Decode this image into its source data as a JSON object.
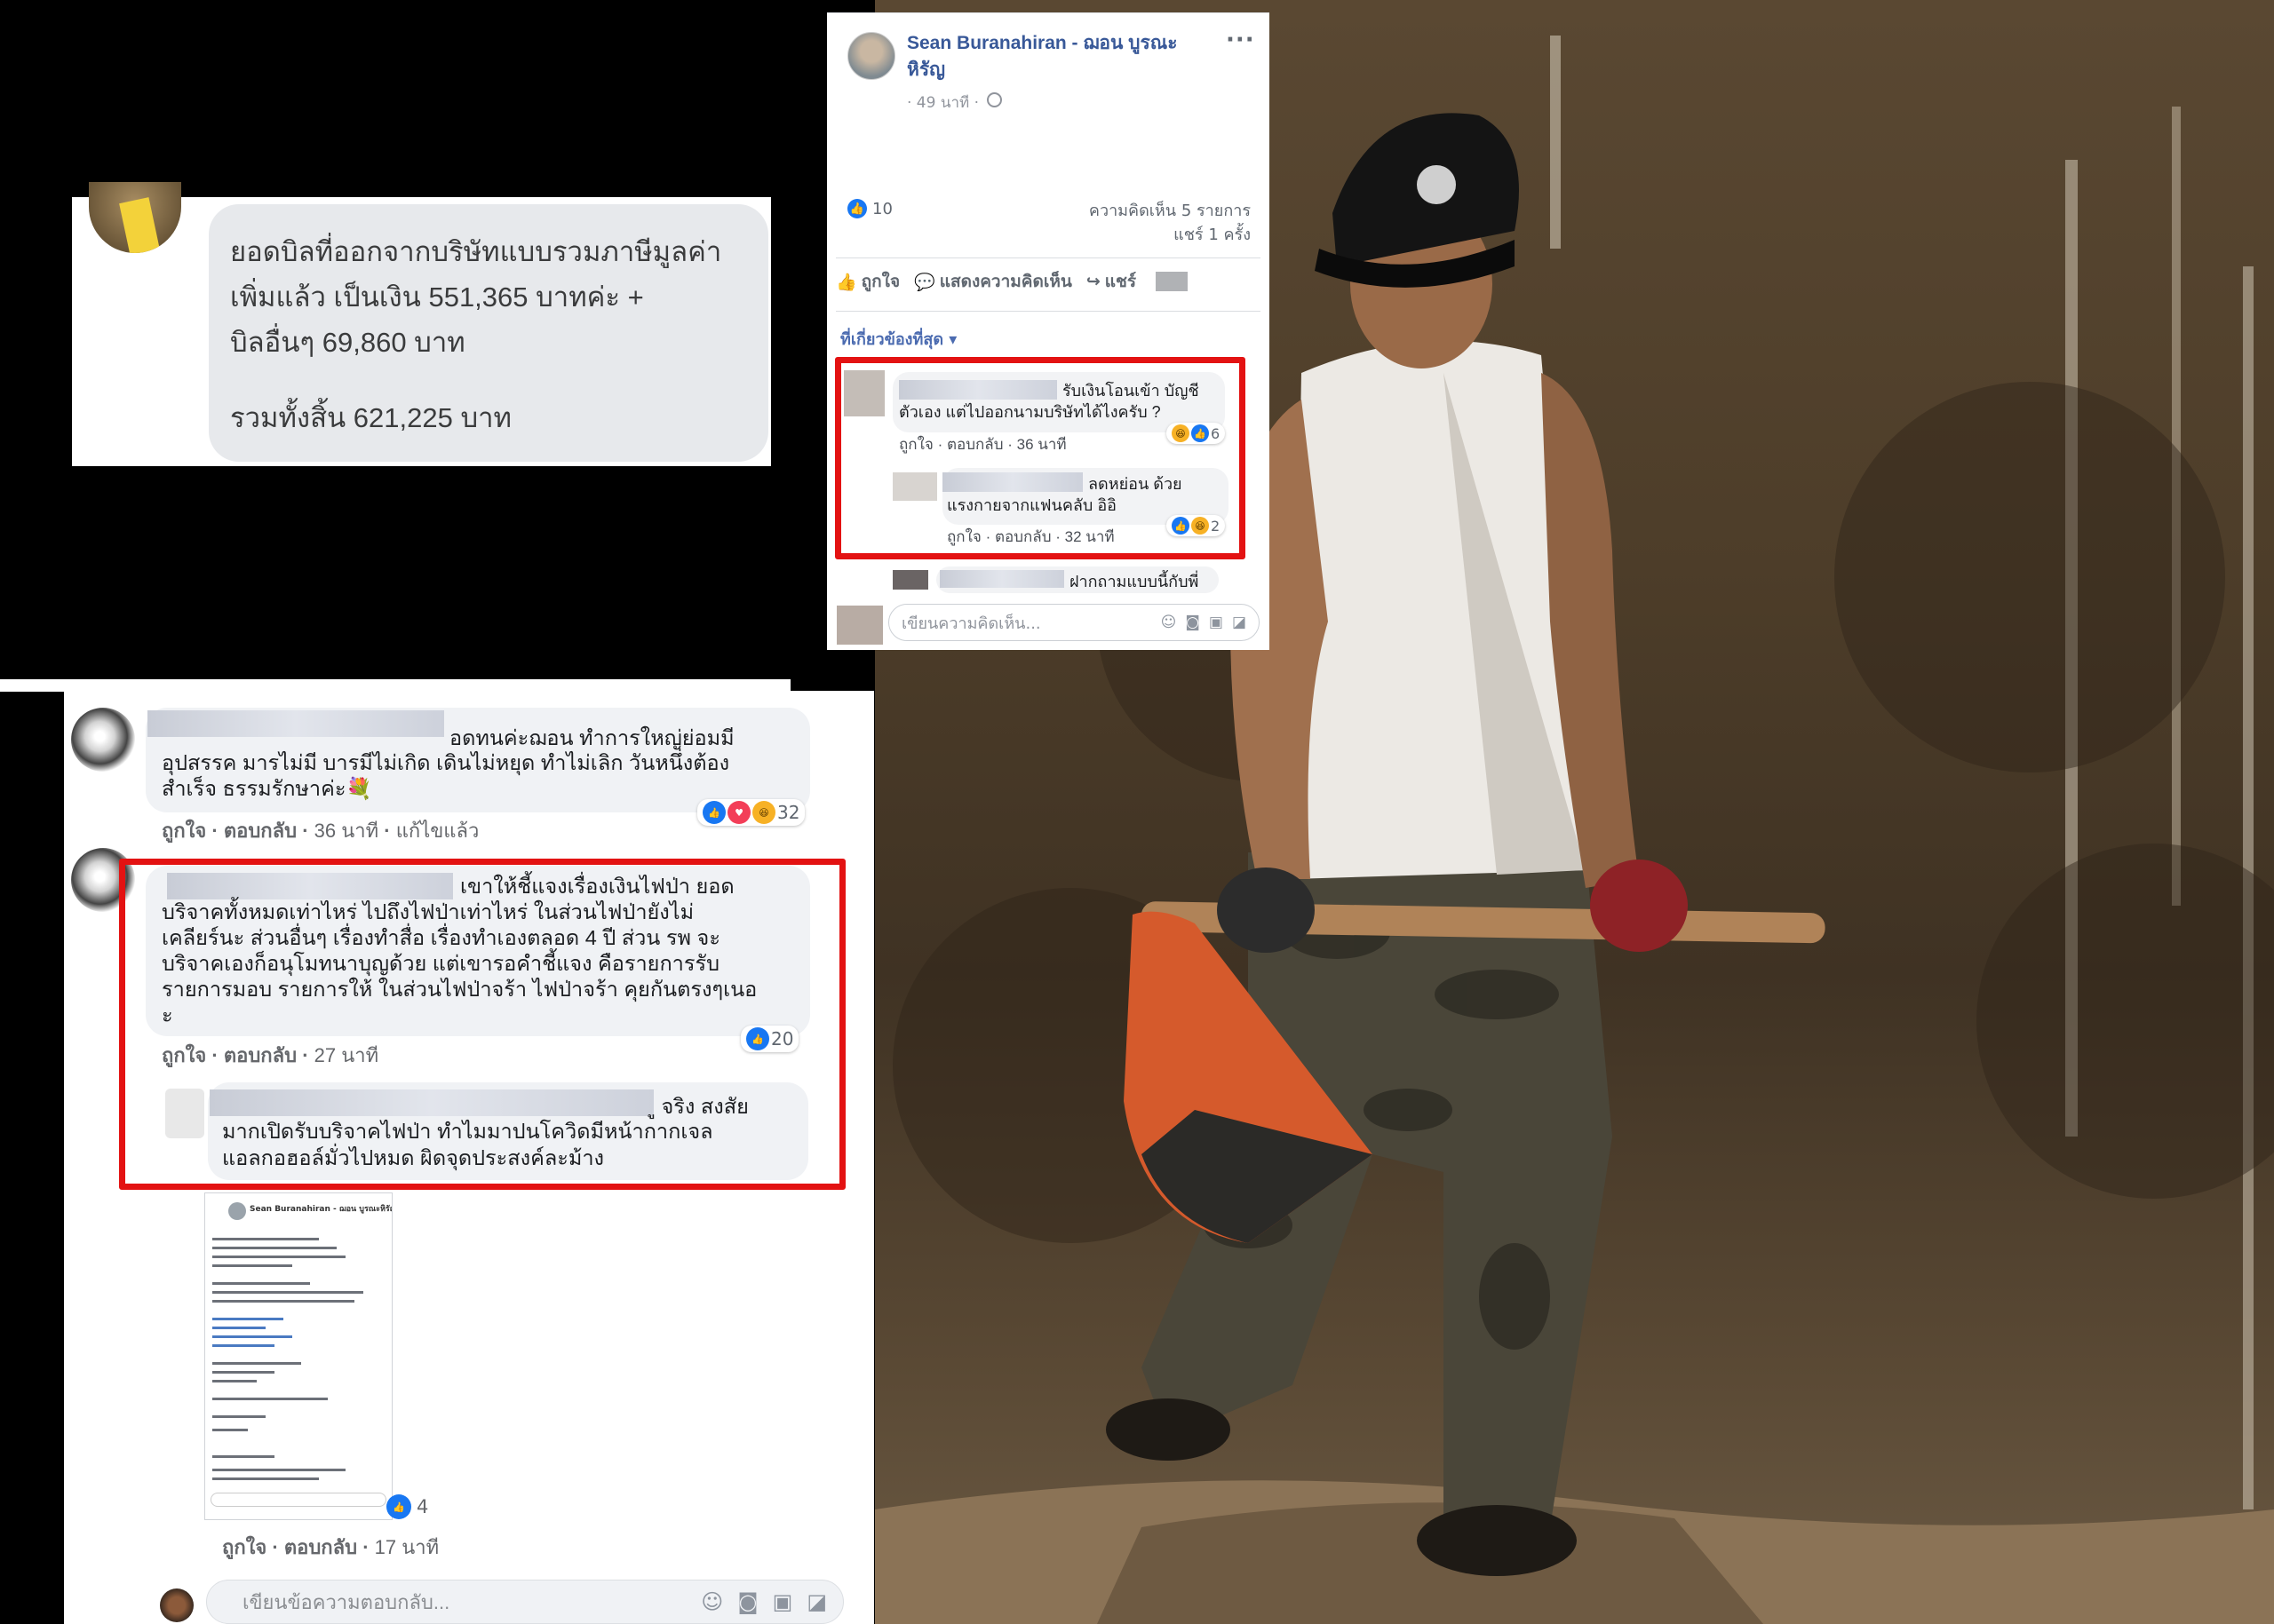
{
  "chat": {
    "line1": "ยอดบิลที่ออกจากบริษัทแบบรวมภาษีมูลค่า",
    "line2": "เพิ่มแล้ว เป็นเงิน 551,365 บาทค่ะ +",
    "line3": "บิลอื่นๆ 69,860 บาท",
    "total": "รวมทั้งสิ้น 621,225 บาท"
  },
  "post": {
    "author": "Sean Buranahiran - ฌอน บูรณะหิรัญ",
    "more": "···",
    "time": "· 49 นาที ·",
    "like_count": "10",
    "comments_count": "ความคิดเห็น 5 รายการ",
    "shares_count": "แชร์ 1 ครั้ง",
    "action_like": "ถูกใจ",
    "action_comment": "แสดงความคิดเห็น",
    "action_share": "แชร์",
    "relevance": "ที่เกี่ยวข้องที่สุด ▾",
    "input_placeholder": "เขียนความคิดเห็น...",
    "comments": [
      {
        "line1": "รับเงินโอนเข้า บัญชี",
        "line2": "ตัวเอง แต่ไปออกนามบริษัทได้ไงครับ ?",
        "reactions": "6",
        "meta_like": "ถูกใจ",
        "meta_reply": "ตอบกลับ",
        "meta_time": "36 นาที"
      },
      {
        "line1": "ลดหย่อน ด้วย",
        "line2": "แรงกายจากแฟนคลับ อิอิ",
        "reactions": "2",
        "meta_like": "ถูกใจ",
        "meta_reply": "ตอบกลับ",
        "meta_time": "32 นาที"
      },
      {
        "line1": "ฝากถามแบบนี้กับพี่"
      }
    ]
  },
  "thread": {
    "c1": {
      "text_l1": "อดทนค่ะฌอน ทำการใหญ่ย่อมมี",
      "text_l2": "อุปสรรค มารไม่มี บารมีไม่เกิด เดินไม่หยุด ทำไม่เลิก วันหนึ่งต้อง",
      "text_l3": "สำเร็จ ธรรมรักษาค่ะ💐",
      "reactions": "32",
      "meta_like": "ถูกใจ",
      "meta_reply": "ตอบกลับ",
      "meta_time": "36 นาที",
      "meta_edited": "แก้ไขแล้ว"
    },
    "c2": {
      "text_l1": "เขาให้ชี้แจงเรื่องเงินไฟป่า ยอด",
      "text_l2": "บริจาคทั้งหมดเท่าไหร่ ไปถึงไฟป่าเท่าไหร่ ในส่วนไฟป่ายังไม่",
      "text_l3": "เคลียร์นะ ส่วนอื่นๆ เรื่องทำสื่อ เรื่องทำเองตลอด 4 ปี ส่วน รพ จะ",
      "text_l4": "บริจาคเองก็อนุโมทนาบุญด้วย แต่เขารอคำชี้แจง คือรายการรับ",
      "text_l5": "รายการมอบ รายการให้ ในส่วนไฟป่าจร้า ไฟป่าจร้า คุยกันตรงๆเนอ",
      "text_l6": "ะ",
      "reactions": "20",
      "meta_like": "ถูกใจ",
      "meta_reply": "ตอบกลับ",
      "meta_time": "27 นาที"
    },
    "c3": {
      "text_l1": "ู จริง สงสัย",
      "text_l2": "มากเปิดรับบริจาคไฟป่า ทำไมมาปนโควิดมีหน้ากากเจล",
      "text_l3": "แอลกอฮอล์มั่วไปหมด ผิดจุดประสงค์ละม้าง"
    },
    "c4": {
      "reactions": "4",
      "meta_like": "ถูกใจ",
      "meta_reply": "ตอบกลับ",
      "meta_time": "17 นาที"
    },
    "input_placeholder": "เขียนข้อความตอบกลับ..."
  },
  "mini_shot": {
    "author": "Sean Buranahiran - ฌอน บูรณะหิรัญ"
  },
  "colors": {
    "fb_blue": "#385898",
    "like_blue": "#1877f2",
    "highlight_red": "#e31212",
    "bubble_grey": "#e7e9ec"
  }
}
